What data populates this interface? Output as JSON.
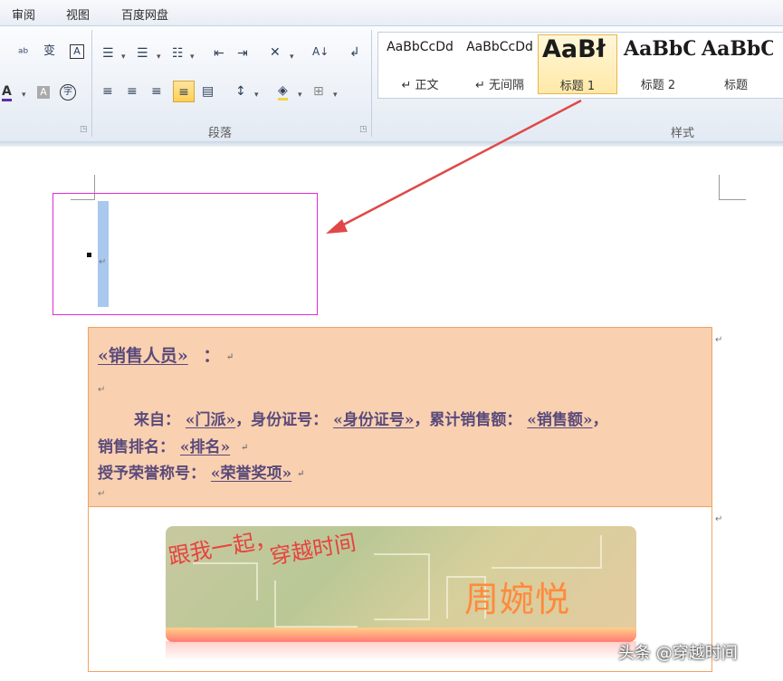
{
  "tabs": [
    "审阅",
    "视图",
    "百度网盘"
  ],
  "ribbon": {
    "paragraph_group_label": "段落",
    "styles_group_label": "样式",
    "styles": [
      {
        "sample": "AaBbCcDd",
        "name": "↵ 正文"
      },
      {
        "sample": "AaBbCcDd",
        "name": "↵ 无间隔"
      },
      {
        "sample": "AaBł",
        "name": "标题 1"
      },
      {
        "sample": "AaBbC",
        "name": "标题 2"
      },
      {
        "sample": "AaBbC",
        "name": "标题"
      }
    ]
  },
  "document": {
    "paragraph_mark": "↵",
    "line1_field": "«销售人员»",
    "line1_suffix": "：",
    "line3_prefix": "来自：",
    "field_menpai": "«门派»",
    "line3_id_label": "，身份证号：",
    "field_id": "«身份证号»",
    "line3_sales_label": "，累计销售额：",
    "field_sales": "«销售额»",
    "line3_end": "，",
    "line4_label": "销售排名：",
    "field_rank": "«排名»",
    "line5_label": "授予荣誉称号：",
    "field_honor": "«荣誉奖项»"
  },
  "banner": {
    "slogan_line1": "跟我一起，",
    "slogan_line2": "穿越时间",
    "name": "周婉悦"
  },
  "watermark": "头条 @穿越时间",
  "colors": {
    "arrow": "#e04848",
    "callout_border": "#e12ad6",
    "row_fill": "#f9d0b0",
    "table_border": "#f0a460",
    "text": "#5a4a7a"
  }
}
